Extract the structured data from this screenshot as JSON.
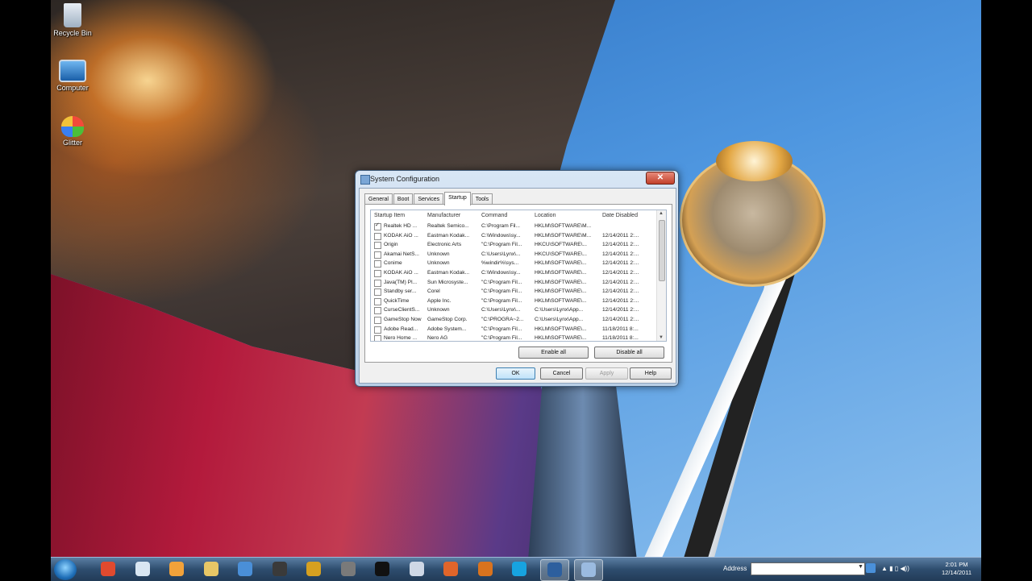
{
  "desktop": {
    "icons": [
      {
        "label": "Recycle Bin"
      },
      {
        "label": "Computer"
      },
      {
        "label": "Glitter"
      }
    ]
  },
  "dialog": {
    "title": "System Configuration",
    "close_label": "✕",
    "tabs": [
      "General",
      "Boot",
      "Services",
      "Startup",
      "Tools"
    ],
    "active_tab": "Startup",
    "columns": [
      "Startup Item",
      "Manufacturer",
      "Command",
      "Location",
      "Date Disabled"
    ],
    "rows": [
      {
        "checked": true,
        "item": "Realtek HD ...",
        "manufacturer": "Realtek Semico...",
        "command": "C:\\Program Fil...",
        "location": "HKLM\\SOFTWARE\\M...",
        "date": ""
      },
      {
        "checked": false,
        "item": "KODAK AiO ...",
        "manufacturer": "Eastman Kodak...",
        "command": "C:\\Windows\\sy...",
        "location": "HKLM\\SOFTWARE\\M...",
        "date": "12/14/2011 2:..."
      },
      {
        "checked": false,
        "item": "Origin",
        "manufacturer": "Electronic Arts",
        "command": "\"C:\\Program Fil...",
        "location": "HKCU\\SOFTWARE\\...",
        "date": "12/14/2011 2:..."
      },
      {
        "checked": false,
        "item": "Akamai NetS...",
        "manufacturer": "Unknown",
        "command": "C:\\Users\\Lynx\\...",
        "location": "HKCU\\SOFTWARE\\...",
        "date": "12/14/2011 2:..."
      },
      {
        "checked": false,
        "item": "Conime",
        "manufacturer": "Unknown",
        "command": "%windir%\\sys...",
        "location": "HKLM\\SOFTWARE\\...",
        "date": "12/14/2011 2:..."
      },
      {
        "checked": false,
        "item": "KODAK AiO ...",
        "manufacturer": "Eastman Kodak...",
        "command": "C:\\Windows\\sy...",
        "location": "HKLM\\SOFTWARE\\...",
        "date": "12/14/2011 2:..."
      },
      {
        "checked": false,
        "item": "Java(TM) Pl...",
        "manufacturer": "Sun Microsyste...",
        "command": "\"C:\\Program Fil...",
        "location": "HKLM\\SOFTWARE\\...",
        "date": "12/14/2011 2:..."
      },
      {
        "checked": false,
        "item": "Standby ser...",
        "manufacturer": "Corel",
        "command": "\"C:\\Program Fil...",
        "location": "HKLM\\SOFTWARE\\...",
        "date": "12/14/2011 2:..."
      },
      {
        "checked": false,
        "item": "QuickTime",
        "manufacturer": "Apple Inc.",
        "command": "\"C:\\Program Fil...",
        "location": "HKLM\\SOFTWARE\\...",
        "date": "12/14/2011 2:..."
      },
      {
        "checked": false,
        "item": "CurseClientS...",
        "manufacturer": "Unknown",
        "command": "C:\\Users\\Lynx\\...",
        "location": "C:\\Users\\Lynx\\App...",
        "date": "12/14/2011 2:..."
      },
      {
        "checked": false,
        "item": "GameStop Now",
        "manufacturer": "GameStop Corp.",
        "command": "\"C:\\PROGRA~2...",
        "location": "C:\\Users\\Lynx\\App...",
        "date": "12/14/2011 2:..."
      },
      {
        "checked": false,
        "item": "Adobe Read...",
        "manufacturer": "Adobe System...",
        "command": "\"C:\\Program Fil...",
        "location": "HKLM\\SOFTWARE\\...",
        "date": "11/18/2011 8:..."
      },
      {
        "checked": false,
        "item": "Nero Home ...",
        "manufacturer": "Nero AG",
        "command": "\"C:\\Program Fil...",
        "location": "HKLM\\SOFTWARE\\...",
        "date": "11/18/2011 8:..."
      }
    ],
    "enable_all": "Enable all",
    "disable_all": "Disable all",
    "ok": "OK",
    "cancel": "Cancel",
    "apply": "Apply",
    "help": "Help"
  },
  "taskbar": {
    "apps": [
      {
        "icon": "chrome-icon",
        "color": "#e04a2f"
      },
      {
        "icon": "network-globe-icon",
        "color": "#d9e6f2"
      },
      {
        "icon": "media-player-icon",
        "color": "#f2a23a"
      },
      {
        "icon": "folder-icon",
        "color": "#e8c766"
      },
      {
        "icon": "thunderbird-icon",
        "color": "#4a8fd8"
      },
      {
        "icon": "steam-icon",
        "color": "#3a3a3a"
      },
      {
        "icon": "world-of-warcraft-icon",
        "color": "#d6a020"
      },
      {
        "icon": "origin-icon",
        "color": "#7a7a7a"
      },
      {
        "icon": "gamestop-icon",
        "color": "#111111"
      },
      {
        "icon": "mumble-icon",
        "color": "#cfd8e6"
      },
      {
        "icon": "firefox-icon",
        "color": "#e0652a"
      },
      {
        "icon": "curse-icon",
        "color": "#d9731e"
      },
      {
        "icon": "skype-icon",
        "color": "#17a3e0"
      },
      {
        "icon": "system-config-icon",
        "color": "#2d5f9e"
      },
      {
        "icon": "msconfig-window-icon",
        "color": "#9bbbe0"
      }
    ],
    "address_label": "Address",
    "address_value": "",
    "clock_time": "2:01 PM",
    "clock_date": "12/14/2011"
  }
}
